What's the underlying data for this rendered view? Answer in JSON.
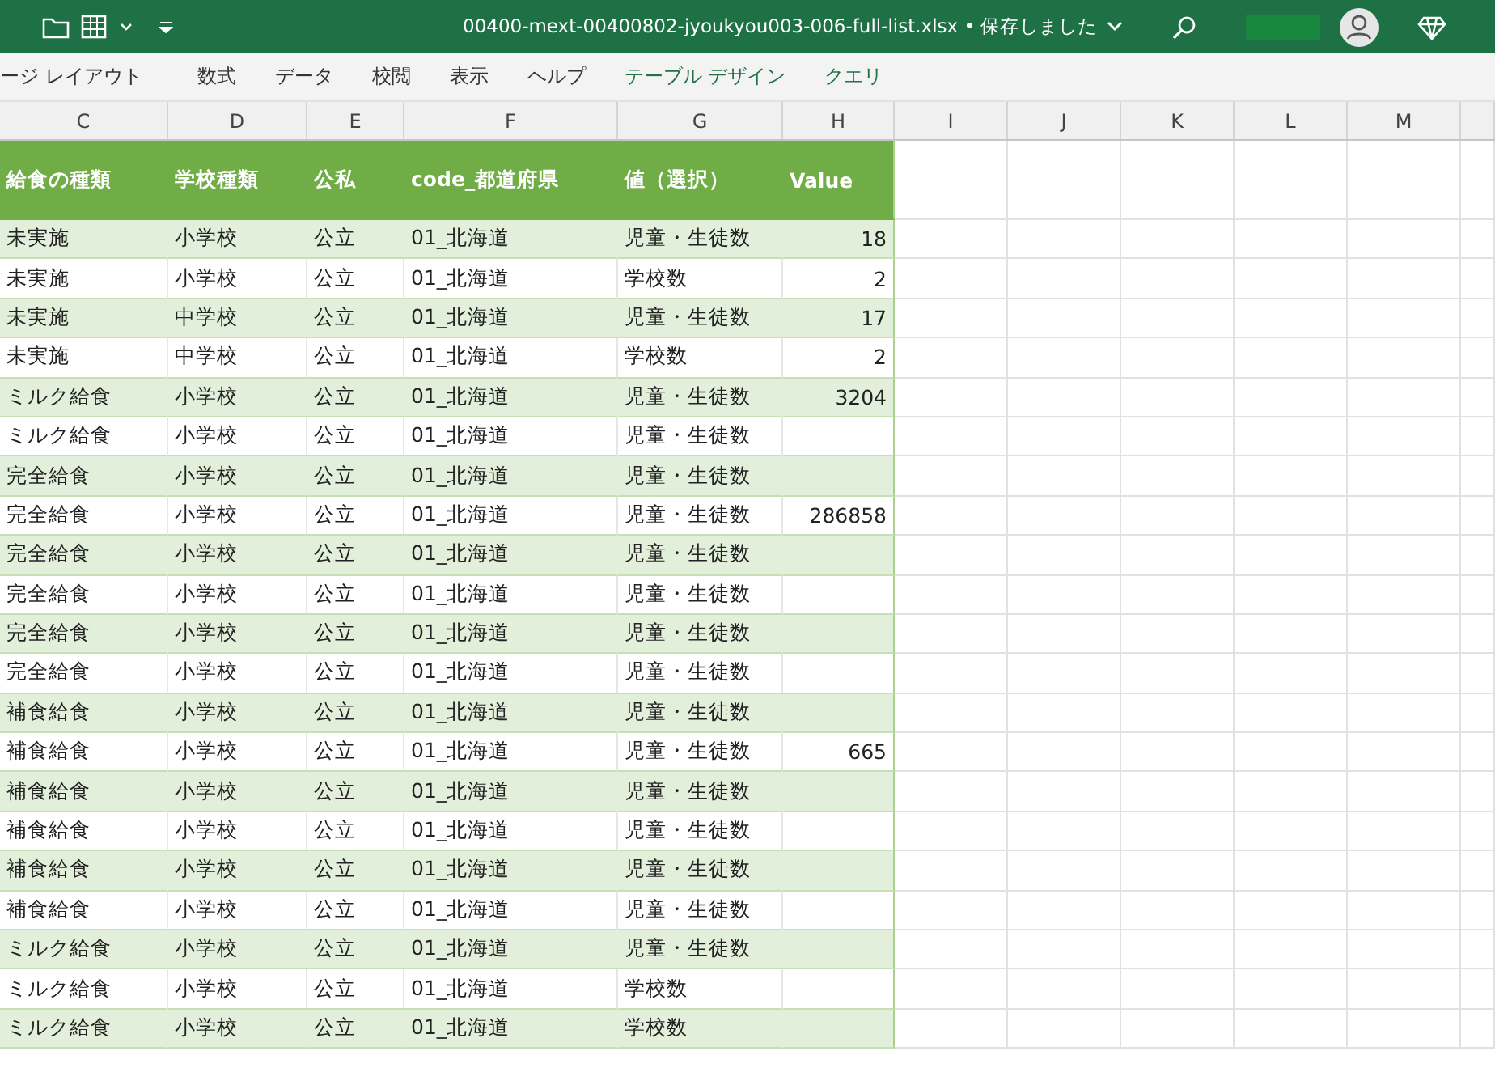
{
  "title_bar": {
    "title": "00400-mext-00400802-jyoukyou003-006-full-list.xlsx • 保存しました"
  },
  "ribbon_tabs": [
    {
      "label": "ージ レイアウト",
      "contextual": false
    },
    {
      "label": "数式",
      "contextual": false
    },
    {
      "label": "データ",
      "contextual": false
    },
    {
      "label": "校閲",
      "contextual": false
    },
    {
      "label": "表示",
      "contextual": false
    },
    {
      "label": "ヘルプ",
      "contextual": false
    },
    {
      "label": "テーブル デザイン",
      "contextual": true
    },
    {
      "label": "クエリ",
      "contextual": true
    }
  ],
  "column_headers": [
    "C",
    "D",
    "E",
    "F",
    "G",
    "H",
    "I",
    "J",
    "K",
    "L",
    "M"
  ],
  "table": {
    "columns": [
      "給食の種類",
      "学校種類",
      "公私",
      "code_都道府県",
      "値（選択）",
      "Value"
    ],
    "rows": [
      [
        "未実施",
        "小学校",
        "公立",
        "01_北海道",
        "児童・生徒数",
        "18"
      ],
      [
        "未実施",
        "小学校",
        "公立",
        "01_北海道",
        "学校数",
        "2"
      ],
      [
        "未実施",
        "中学校",
        "公立",
        "01_北海道",
        "児童・生徒数",
        "17"
      ],
      [
        "未実施",
        "中学校",
        "公立",
        "01_北海道",
        "学校数",
        "2"
      ],
      [
        "ミルク給食",
        "小学校",
        "公立",
        "01_北海道",
        "児童・生徒数",
        "3204"
      ],
      [
        "ミルク給食",
        "小学校",
        "公立",
        "01_北海道",
        "児童・生徒数"
      ],
      [
        "完全給食",
        "小学校",
        "公立",
        "01_北海道",
        "児童・生徒数"
      ],
      [
        "完全給食",
        "小学校",
        "公立",
        "01_北海道",
        "児童・生徒数",
        "286858"
      ],
      [
        "完全給食",
        "小学校",
        "公立",
        "01_北海道",
        "児童・生徒数"
      ],
      [
        "完全給食",
        "小学校",
        "公立",
        "01_北海道",
        "児童・生徒数"
      ],
      [
        "完全給食",
        "小学校",
        "公立",
        "01_北海道",
        "児童・生徒数"
      ],
      [
        "完全給食",
        "小学校",
        "公立",
        "01_北海道",
        "児童・生徒数"
      ],
      [
        "補食給食",
        "小学校",
        "公立",
        "01_北海道",
        "児童・生徒数"
      ],
      [
        "補食給食",
        "小学校",
        "公立",
        "01_北海道",
        "児童・生徒数",
        "665"
      ],
      [
        "補食給食",
        "小学校",
        "公立",
        "01_北海道",
        "児童・生徒数"
      ],
      [
        "補食給食",
        "小学校",
        "公立",
        "01_北海道",
        "児童・生徒数"
      ],
      [
        "補食給食",
        "小学校",
        "公立",
        "01_北海道",
        "児童・生徒数"
      ],
      [
        "補食給食",
        "小学校",
        "公立",
        "01_北海道",
        "児童・生徒数"
      ],
      [
        "ミルク給食",
        "小学校",
        "公立",
        "01_北海道",
        "児童・生徒数"
      ],
      [
        "ミルク給食",
        "小学校",
        "公立",
        "01_北海道",
        "学校数"
      ],
      [
        "ミルク給食",
        "小学校",
        "公立",
        "01_北海道",
        "学校数"
      ]
    ]
  }
}
